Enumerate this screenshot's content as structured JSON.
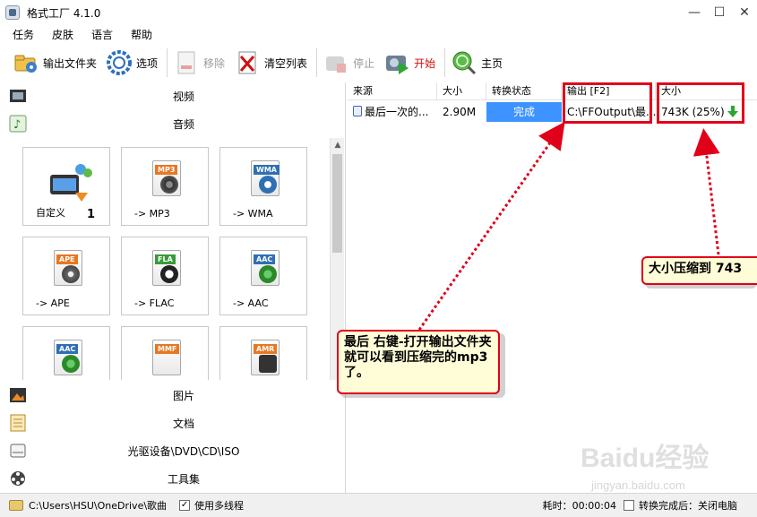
{
  "window": {
    "title": "格式工厂 4.1.0",
    "controls": [
      "—",
      "☐",
      "✕"
    ]
  },
  "menu": [
    "任务",
    "皮肤",
    "语言",
    "帮助"
  ],
  "toolbar": {
    "output_folder": "输出文件夹",
    "options": "选项",
    "remove": "移除",
    "clear_list": "清空列表",
    "stop": "停止",
    "start": "开始",
    "home": "主页"
  },
  "categories": {
    "video": "视频",
    "audio": "音频",
    "image": "图片",
    "document": "文档",
    "disc": "光驱设备\\DVD\\CD\\ISO",
    "tools": "工具集"
  },
  "tiles": [
    {
      "label": "自定义",
      "badge": "1",
      "icon": "custom-icon"
    },
    {
      "label": "-> MP3",
      "tag": "MP3",
      "tag_color": "#e87722",
      "icon": "mp3-icon"
    },
    {
      "label": "-> WMA",
      "tag": "WMA",
      "tag_color": "#2f6fb5",
      "icon": "wma-icon"
    },
    {
      "label": "-> APE",
      "tag": "APE",
      "tag_color": "#e87722",
      "icon": "ape-icon"
    },
    {
      "label": "-> FLAC",
      "tag": "FLA",
      "tag_color": "#3a9a3a",
      "icon": "flac-icon"
    },
    {
      "label": "-> AAC",
      "tag": "AAC",
      "tag_color": "#2f6fb5",
      "icon": "aac-icon"
    },
    {
      "label": "",
      "tag": "AAC",
      "tag_color": "#2f6fb5",
      "icon": "aac-icon"
    },
    {
      "label": "",
      "tag": "MMF",
      "tag_color": "#e87722",
      "icon": "mmf-icon"
    },
    {
      "label": "",
      "tag": "AMR",
      "tag_color": "#e87722",
      "icon": "amr-icon"
    }
  ],
  "list": {
    "columns": [
      "来源",
      "大小",
      "转换状态",
      "输出 [F2]",
      "大小"
    ],
    "rows": [
      {
        "source": "最后一次的...",
        "size": "2.90M",
        "status": "完成",
        "output": "C:\\FFOutput\\最...",
        "out_size": "743K  (25%)"
      }
    ]
  },
  "annotations": {
    "callout_left": "最后 右键-打开输出文件夹 就可以看到压缩完的mp3 了。",
    "callout_right": "大小压缩到 743"
  },
  "status": {
    "path": "C:\\Users\\HSU\\OneDrive\\歌曲",
    "multithread": "使用多线程",
    "elapsed": "耗时：00:00:04",
    "after_done": "转换完成后：关闭电脑"
  },
  "watermark": {
    "brand": "Baidu经验",
    "url": "jingyan.baidu.com"
  },
  "colors": {
    "status_done": "#3d93ff",
    "annotation_red": "#e0001a",
    "callout_bg": "#fffcd8"
  }
}
